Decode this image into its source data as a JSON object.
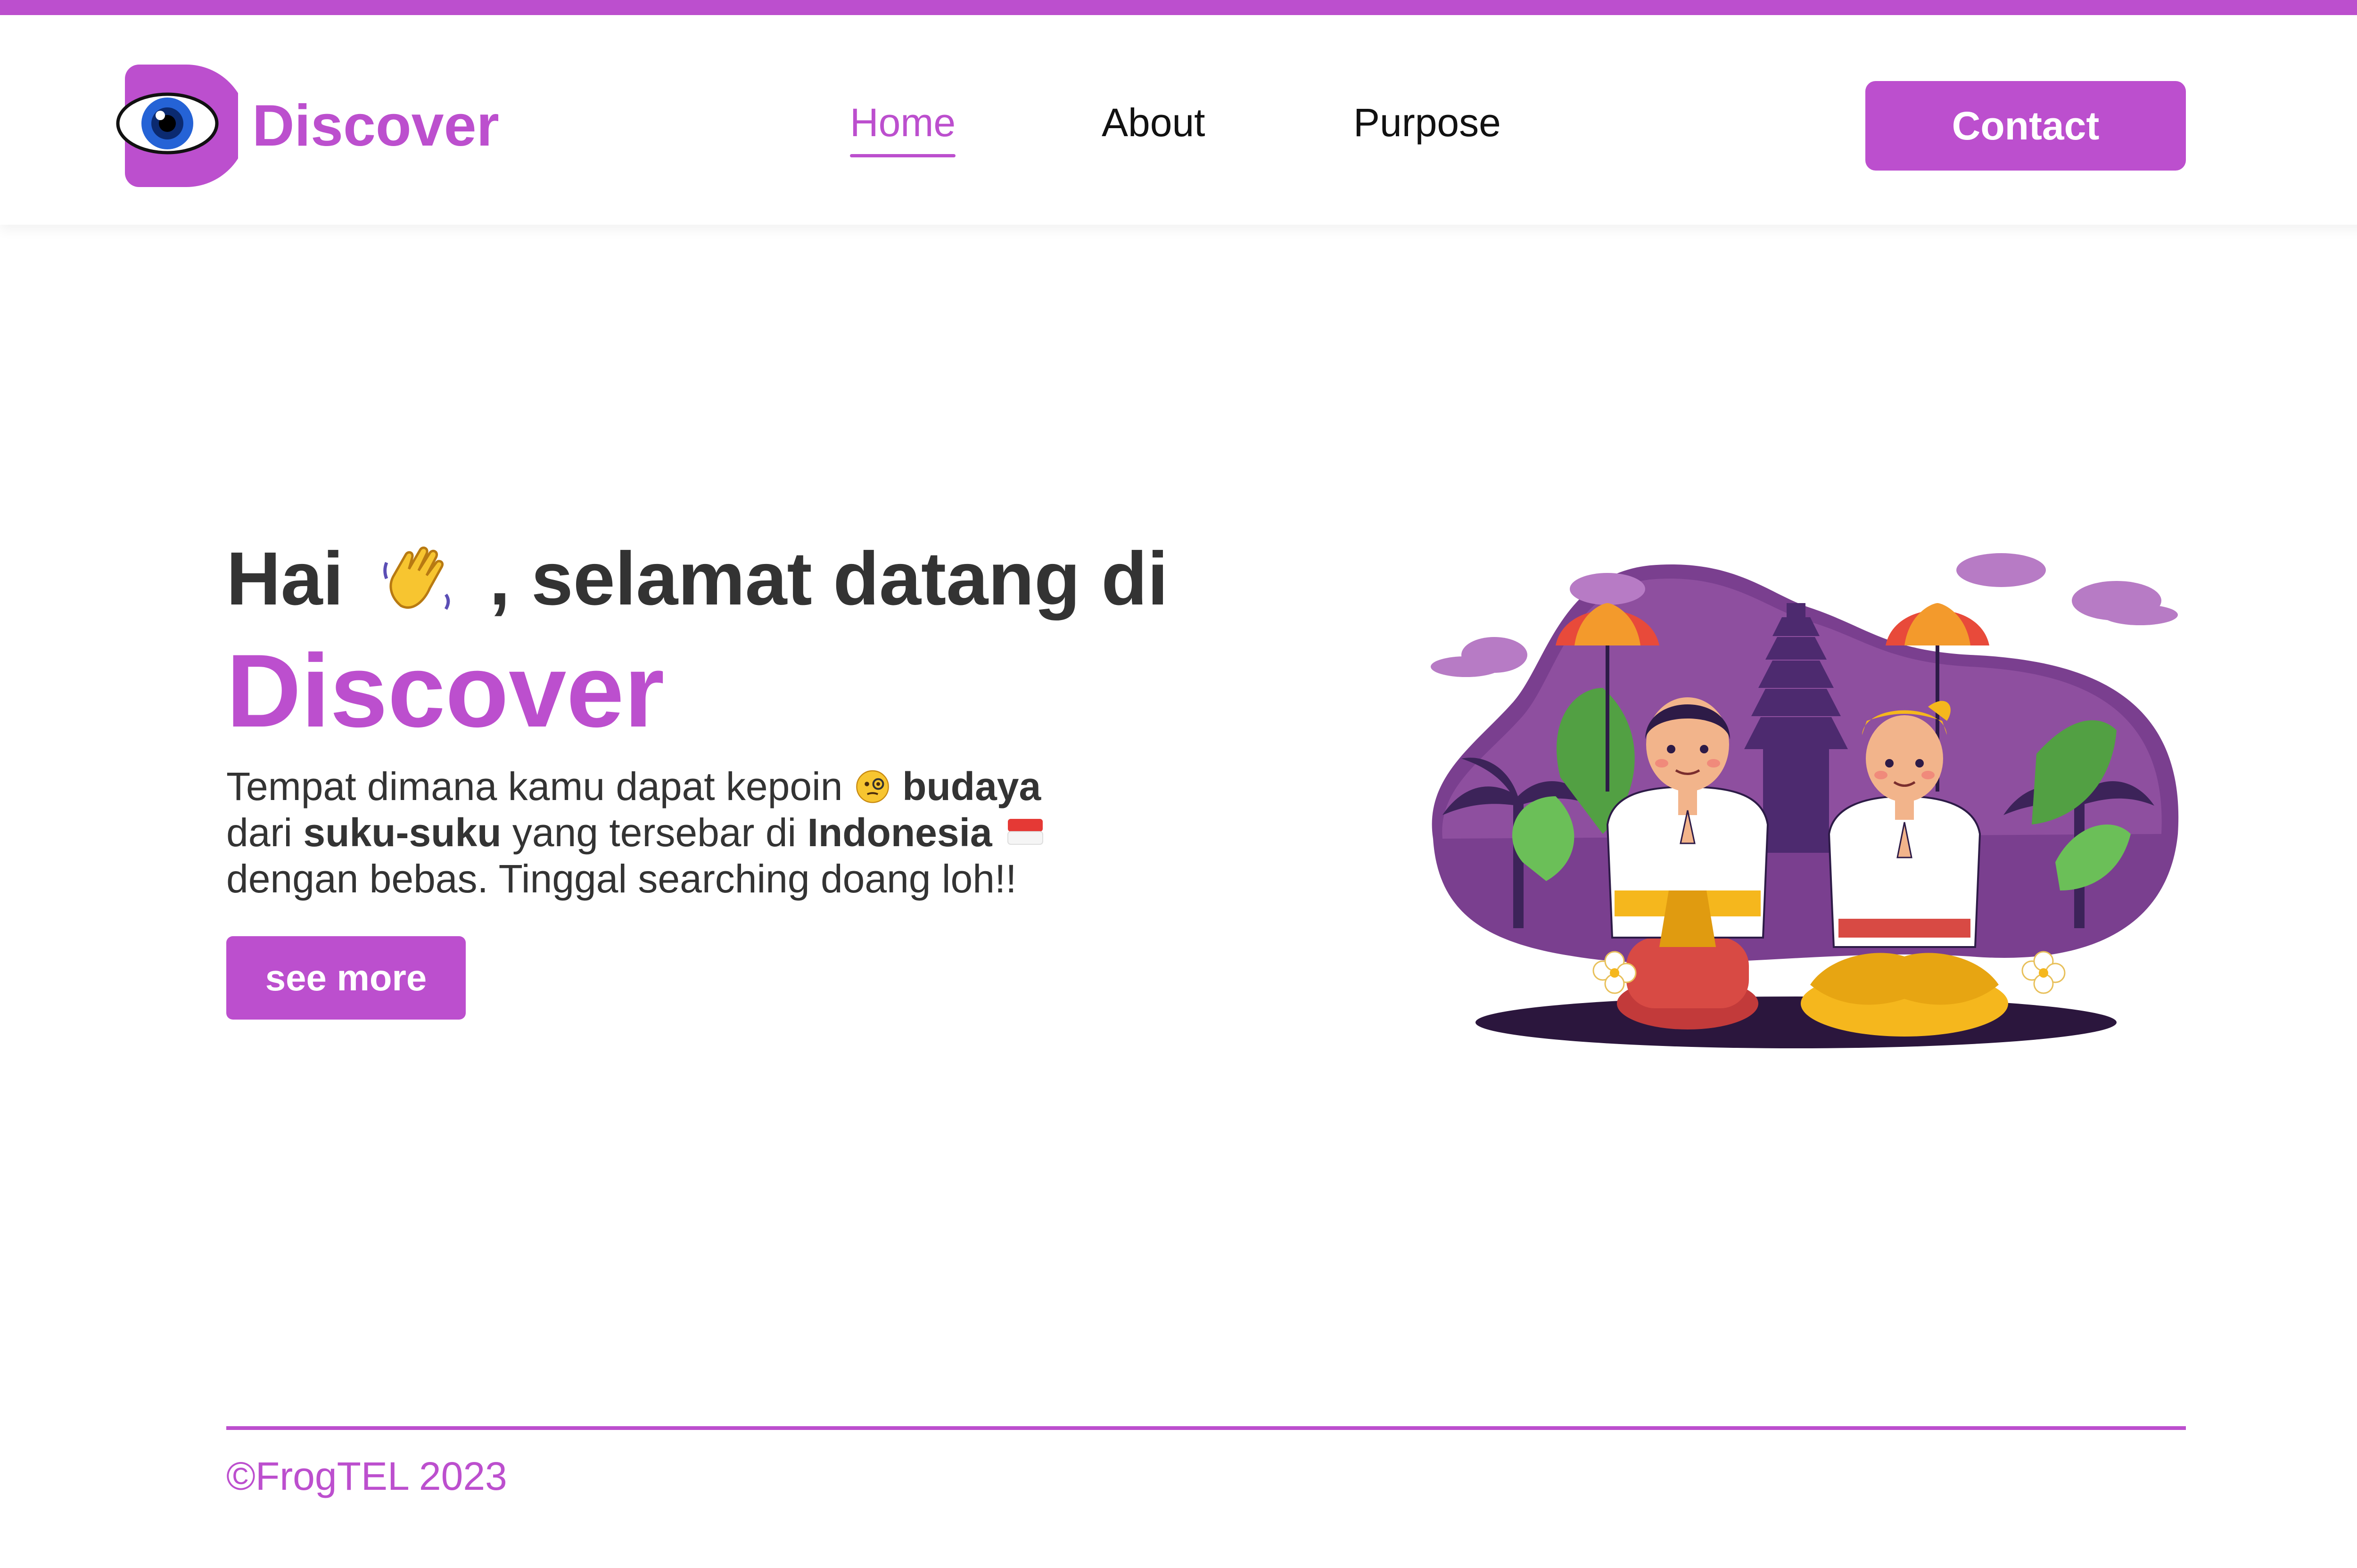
{
  "header": {
    "brand": "Discover",
    "nav": [
      {
        "label": "Home"
      },
      {
        "label": "About"
      },
      {
        "label": "Purpose"
      }
    ],
    "contact_label": "Contact"
  },
  "hero": {
    "greeting_start": "Hai",
    "greeting_end": ", selamat datang di",
    "brand": "Discover",
    "text": {
      "p1": "Tempat dimana kamu dapat kepoin",
      "b1": "budaya",
      "p2": "dari",
      "b2": "suku-suku",
      "p3": "yang tersebar di",
      "b3": "Indonesia",
      "p4": "dengan bebas. Tinggal searching doang loh!!"
    },
    "button_label": "see more",
    "icons": {
      "wave": "waving-hand-icon",
      "face": "face-with-monocle-icon",
      "flag": "indonesia-flag-icon"
    }
  },
  "footer": {
    "copyright": "©FrogTEL 2023"
  },
  "colors": {
    "accent": "#bc4fce",
    "text": "#333333",
    "background": "#ffffff"
  }
}
